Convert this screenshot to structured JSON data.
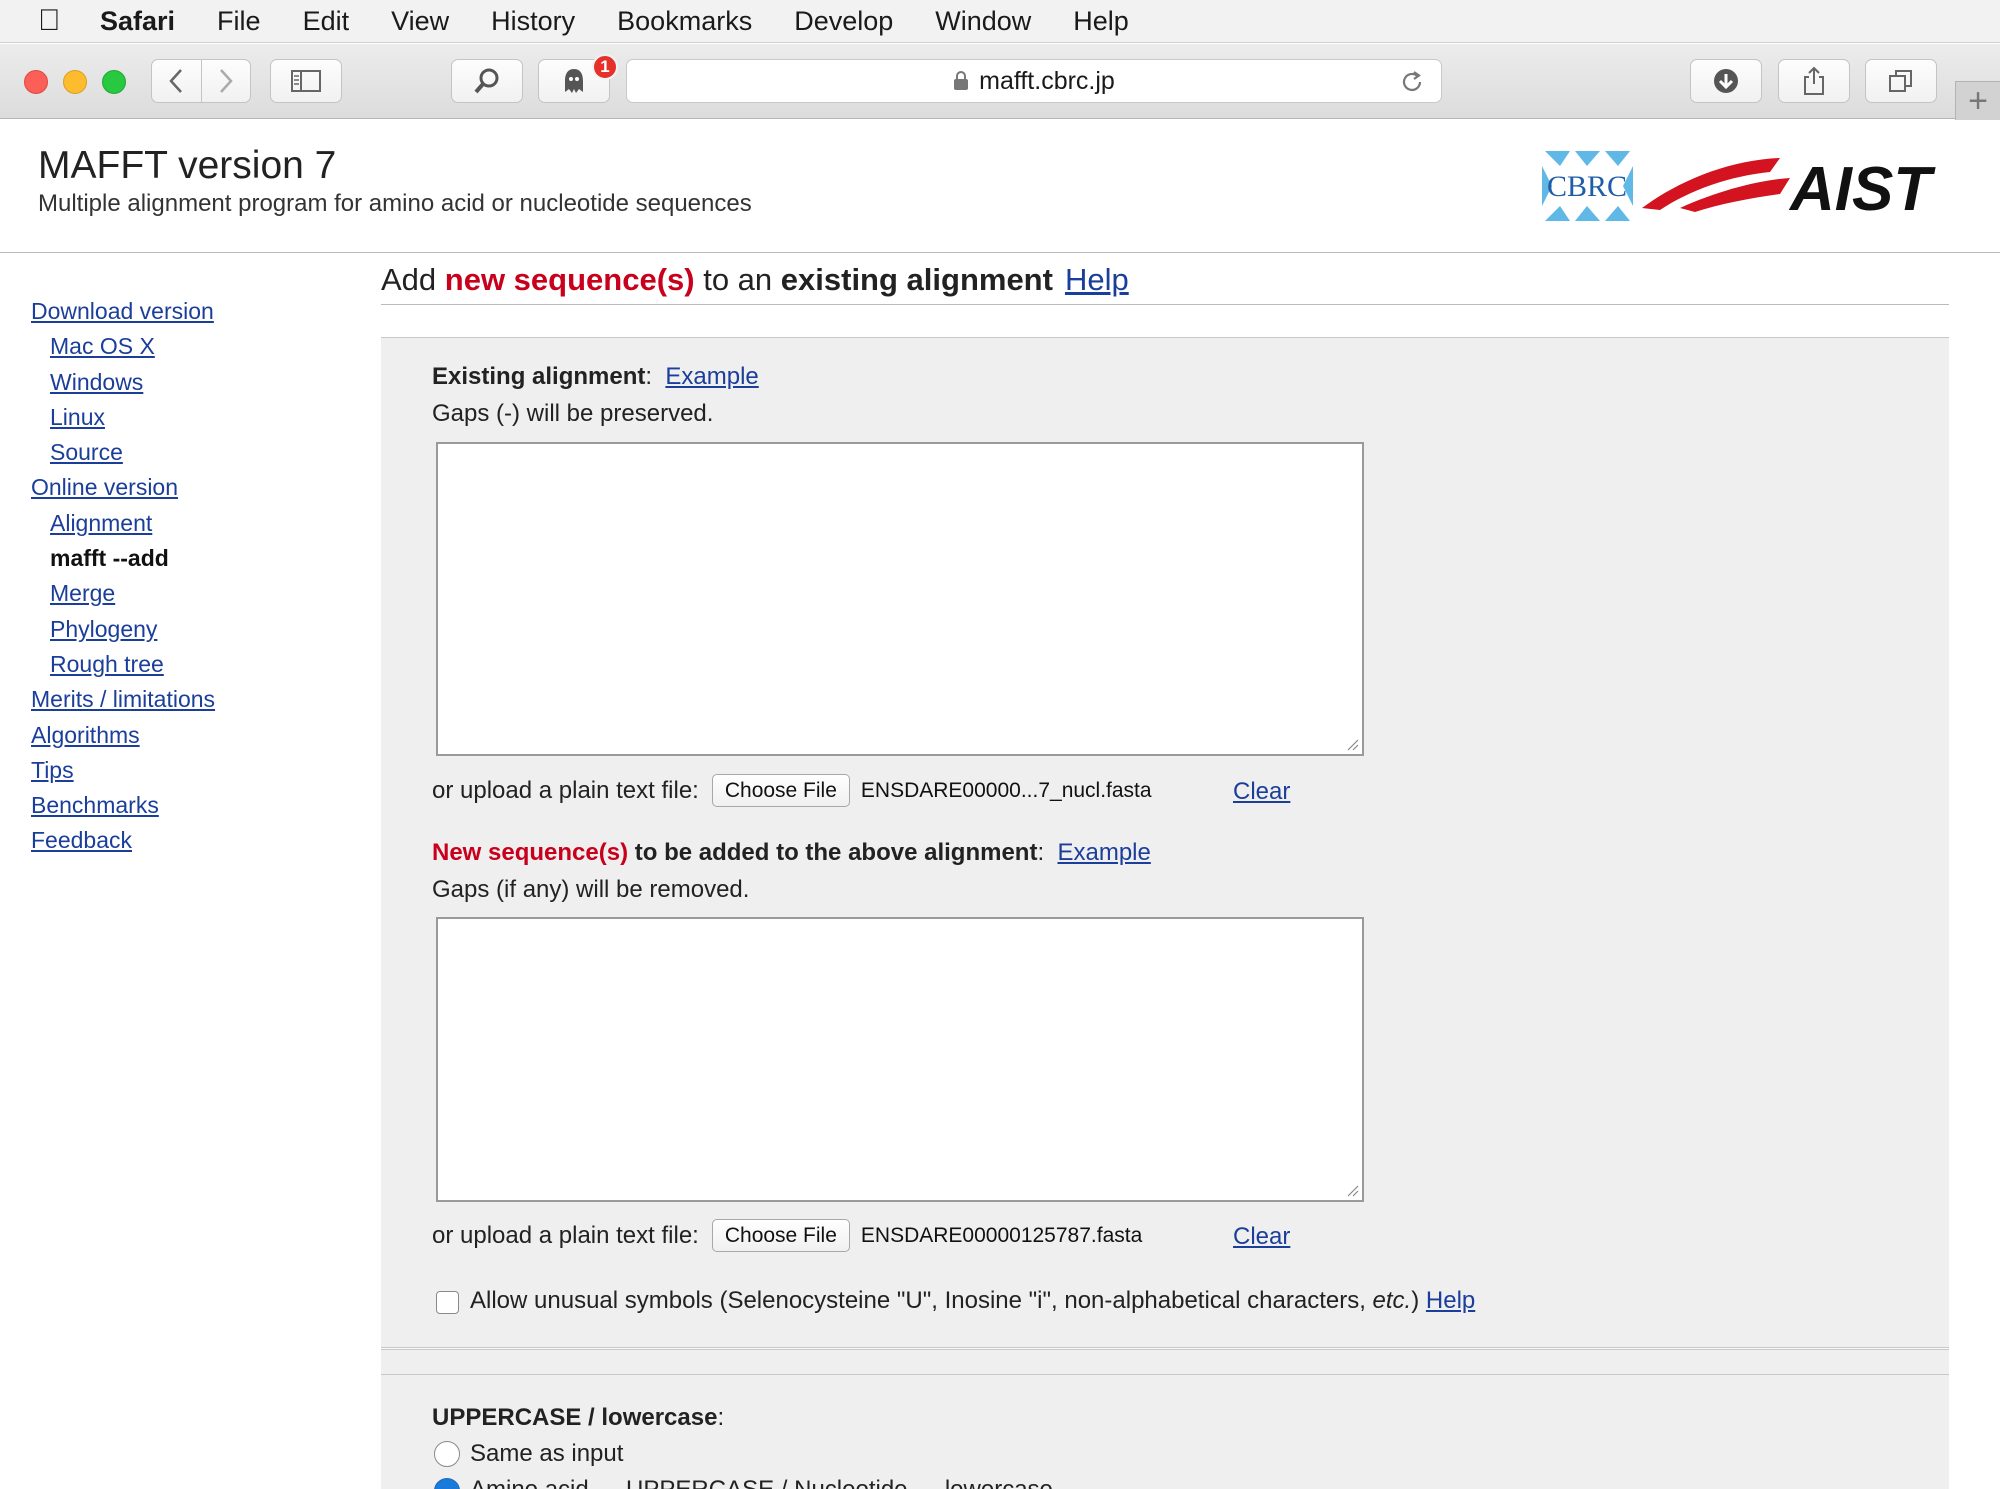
{
  "menubar": {
    "app": "Safari",
    "items": [
      "File",
      "Edit",
      "View",
      "History",
      "Bookmarks",
      "Develop",
      "Window",
      "Help"
    ]
  },
  "toolbar": {
    "url": "mafft.cbrc.jp",
    "badge_count": "1"
  },
  "header": {
    "title": "MAFFT version 7",
    "subtitle": "Multiple alignment program for amino acid or nucleotide sequences",
    "logo_left": "CBRC",
    "logo_right": "AIST"
  },
  "sidebar": {
    "items": [
      {
        "label": "Download version",
        "level": 0
      },
      {
        "label": "Mac OS X",
        "level": 1
      },
      {
        "label": "Windows",
        "level": 1
      },
      {
        "label": "Linux",
        "level": 1
      },
      {
        "label": "Source",
        "level": 1
      },
      {
        "label": "Online version",
        "level": 0
      },
      {
        "label": "Alignment",
        "level": 1
      },
      {
        "label": "mafft --add",
        "level": 1,
        "current": true
      },
      {
        "label": "Merge",
        "level": 1
      },
      {
        "label": "Phylogeny",
        "level": 1
      },
      {
        "label": "Rough tree",
        "level": 1
      },
      {
        "label": "Merits / limitations",
        "level": 0
      },
      {
        "label": "Algorithms",
        "level": 0
      },
      {
        "label": "Tips",
        "level": 0
      },
      {
        "label": "Benchmarks",
        "level": 0
      },
      {
        "label": "Feedback",
        "level": 0
      }
    ]
  },
  "main": {
    "title_pre": "Add ",
    "title_red": "new sequence(s)",
    "title_mid": " to an ",
    "title_bold": "existing alignment",
    "title_help": "Help",
    "existing": {
      "label": "Existing alignment",
      "colon": ":",
      "example": "Example",
      "note": "Gaps (-) will be preserved.",
      "value": "",
      "upload_label": "or upload a plain text file:",
      "choose": "Choose File",
      "filename": "ENSDARE00000...7_nucl.fasta",
      "clear": "Clear"
    },
    "newseq": {
      "label_red": "New sequence(s)",
      "label_rest": " to be added to the above alignment",
      "colon": ":",
      "example": "Example",
      "note": "Gaps (if any) will be removed.",
      "value": "",
      "upload_label": "or upload a plain text file:",
      "choose": "Choose File",
      "filename": "ENSDARE00000125787.fasta",
      "clear": "Clear"
    },
    "unusual": {
      "text_pre": "Allow unusual symbols (Selenocysteine \"U\", Inosine \"i\", non-alphabetical characters, ",
      "text_em": "etc.",
      "text_post": ")",
      "help": "Help",
      "checked": false
    },
    "case": {
      "label": "UPPERCASE / lowercase",
      "colon": ":",
      "option1": "Same as input",
      "option1_checked": false,
      "option2": "Amino acid → UPPERCASE / Nucleotide → lowercase",
      "option2_checked": true
    }
  }
}
